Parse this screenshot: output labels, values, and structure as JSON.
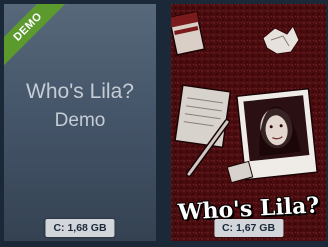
{
  "library": {
    "demo_card": {
      "ribbon_label": "DEMO",
      "title": "Who's Lila?",
      "subtitle": "Demo",
      "install_size": "C: 1,68 GB",
      "ribbon_color": "#5c9a2d"
    },
    "game_card": {
      "cover_title": "Who's Lila?",
      "install_size": "C: 1,67 GB",
      "theme_color": "#4a0c0e"
    }
  }
}
